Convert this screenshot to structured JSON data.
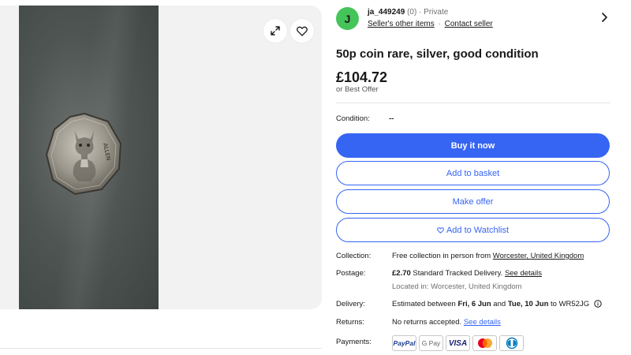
{
  "gallery": {
    "expand_icon": "expand-arrows-icon",
    "watch_icon": "heart-icon",
    "coin_text": "ALLEN"
  },
  "seller": {
    "avatar_letter": "J",
    "username": "ja_449249",
    "meta": "(0) · Private",
    "other_items": "Seller's other items",
    "separator": "·",
    "contact": "Contact seller"
  },
  "listing": {
    "title": "50p coin rare, silver, good condition",
    "price": "£104.72",
    "best_offer": "or Best Offer"
  },
  "condition": {
    "label": "Condition:",
    "value": "--"
  },
  "buttons": {
    "buy_now": "Buy it now",
    "add_basket": "Add to basket",
    "make_offer": "Make offer",
    "watchlist": "Add to Watchlist"
  },
  "details": {
    "collection": {
      "label": "Collection:",
      "text": "Free collection in person from ",
      "link": "Worcester, United Kingdom"
    },
    "postage": {
      "label": "Postage:",
      "price": "£2.70",
      "text": " Standard Tracked Delivery. ",
      "link": "See details",
      "location": "Located in: Worcester, United Kingdom"
    },
    "delivery": {
      "label": "Delivery:",
      "prefix": "Estimated between ",
      "from": "Fri, 6 Jun",
      "and": " and ",
      "to": "Tue, 10 Jun",
      "suffix": " to WR52JG"
    },
    "returns": {
      "label": "Returns:",
      "text": "No returns accepted. ",
      "link": "See details"
    },
    "payments": {
      "label": "Payments:",
      "methods": [
        "PayPal",
        "G Pay",
        "VISA",
        "Mastercard",
        "Diners Club"
      ]
    }
  },
  "colors": {
    "accent": "#3665f3",
    "avatar": "#45c45a",
    "gallery_bg": "#f2f2f2"
  }
}
